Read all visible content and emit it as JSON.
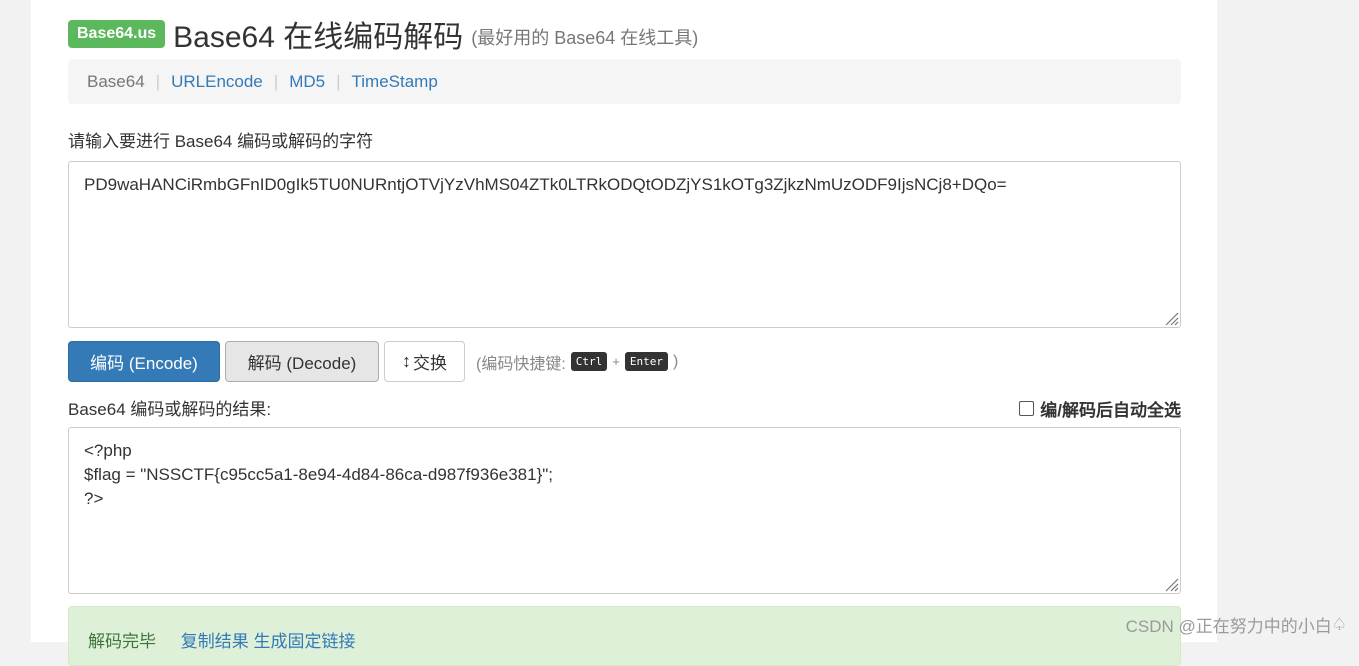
{
  "header": {
    "logo": "Base64.us",
    "title": "Base64 在线编码解码",
    "subtitle": "(最好用的 Base64 在线工具)"
  },
  "nav": {
    "items": [
      {
        "label": "Base64",
        "active": true
      },
      {
        "label": "URLEncode",
        "active": false
      },
      {
        "label": "MD5",
        "active": false
      },
      {
        "label": "TimeStamp",
        "active": false
      }
    ],
    "separator": "|"
  },
  "input": {
    "label": "请输入要进行 Base64 编码或解码的字符",
    "value": "PD9waHANCiRmbGFnID0gIk5TU0NURntjOTVjYzVhMS04ZTk0LTRkODQtODZjYS1kOTg3ZjkzNmUzODF9IjsNCj8+DQo="
  },
  "buttons": {
    "encode": "编码 (Encode)",
    "decode": "解码 (Decode)",
    "swap": "交换",
    "swap_icon": "↕",
    "hint_prefix": "(编码快捷键:",
    "key1": "Ctrl",
    "plus": "+",
    "key2": "Enter",
    "hint_suffix": ")"
  },
  "output": {
    "label": "Base64 编码或解码的结果:",
    "auto_select_label": "编/解码后自动全选",
    "value": "<?php\n$flag = \"NSSCTF{c95cc5a1-8e94-4d84-86ca-d987f936e381}\";\n?>"
  },
  "alert": {
    "status": "解码完毕",
    "copy_link": "复制结果",
    "permalink": "生成固定链接"
  },
  "watermark": {
    "text": "CSDN @正在努力中的小白",
    "icon": "♤"
  },
  "colors": {
    "primary": "#337ab7",
    "logo_green": "#5cb85c",
    "success_bg": "#dff0d8"
  }
}
